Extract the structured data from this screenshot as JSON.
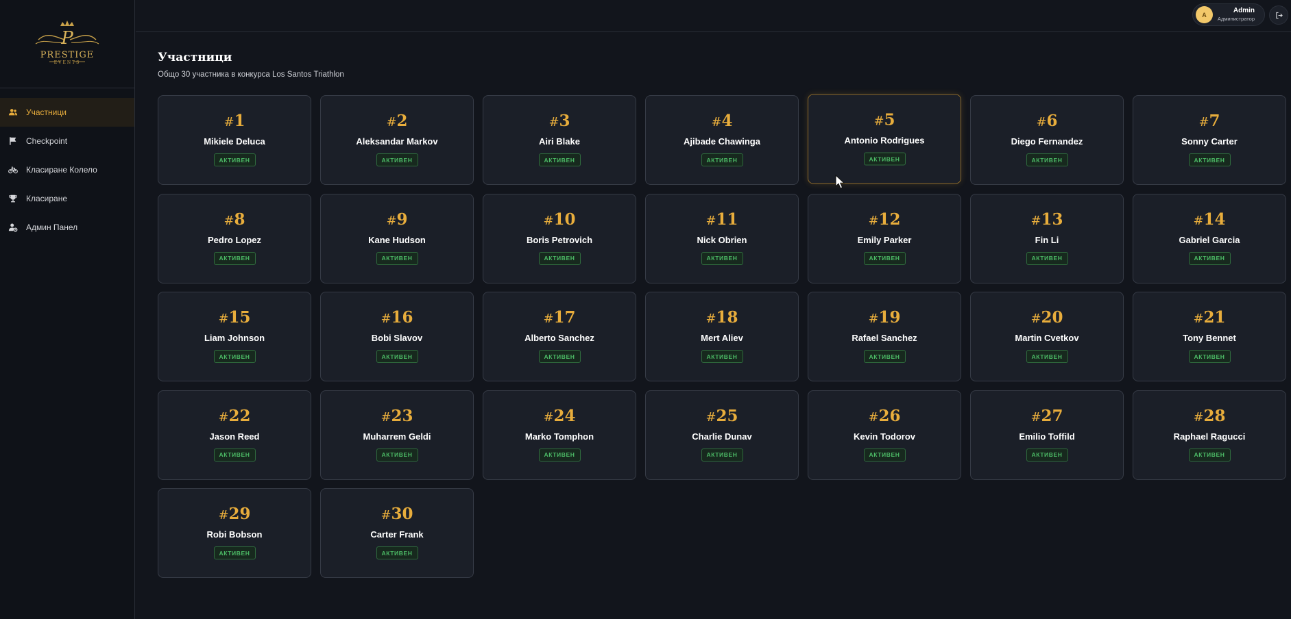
{
  "brand": {
    "logo_text": "PRESTIGE",
    "logo_subtext": "EVENTS",
    "logo_initial": "P"
  },
  "sidebar": {
    "items": [
      {
        "label": "Участници",
        "icon": "users-icon",
        "active": true
      },
      {
        "label": "Checkpoint",
        "icon": "flag-icon",
        "active": false
      },
      {
        "label": "Класиране Колело",
        "icon": "bicycle-icon",
        "active": false
      },
      {
        "label": "Класиране",
        "icon": "trophy-icon",
        "active": false
      },
      {
        "label": "Админ Панел",
        "icon": "admin-cog-icon",
        "active": false
      }
    ]
  },
  "header": {
    "user": {
      "initial": "A",
      "name": "Admin",
      "role": "Администратор"
    },
    "logout_icon": "logout-icon"
  },
  "page": {
    "title": "Участници",
    "subtitle": "Общо 30 участника в конкурса Los Santos Triathlon"
  },
  "participants": [
    {
      "number": "1",
      "name": "Mikiele Deluca",
      "status": "АКТИВЕН"
    },
    {
      "number": "2",
      "name": "Aleksandar Markov",
      "status": "АКТИВЕН"
    },
    {
      "number": "3",
      "name": "Airi Blake",
      "status": "АКТИВЕН"
    },
    {
      "number": "4",
      "name": "Ajibade Chawinga",
      "status": "АКТИВЕН"
    },
    {
      "number": "5",
      "name": "Antonio Rodrigues",
      "status": "АКТИВЕН"
    },
    {
      "number": "6",
      "name": "Diego Fernandez",
      "status": "АКТИВЕН"
    },
    {
      "number": "7",
      "name": "Sonny Carter",
      "status": "АКТИВЕН"
    },
    {
      "number": "8",
      "name": "Pedro Lopez",
      "status": "АКТИВЕН"
    },
    {
      "number": "9",
      "name": "Kane Hudson",
      "status": "АКТИВЕН"
    },
    {
      "number": "10",
      "name": "Boris Petrovich",
      "status": "АКТИВЕН"
    },
    {
      "number": "11",
      "name": "Nick Obrien",
      "status": "АКТИВЕН"
    },
    {
      "number": "12",
      "name": "Emily Parker",
      "status": "АКТИВЕН"
    },
    {
      "number": "13",
      "name": "Fin Li",
      "status": "АКТИВЕН"
    },
    {
      "number": "14",
      "name": "Gabriel Garcia",
      "status": "АКТИВЕН"
    },
    {
      "number": "15",
      "name": "Liam Johnson",
      "status": "АКТИВЕН"
    },
    {
      "number": "16",
      "name": "Bobi Slavov",
      "status": "АКТИВЕН"
    },
    {
      "number": "17",
      "name": "Alberto Sanchez",
      "status": "АКТИВЕН"
    },
    {
      "number": "18",
      "name": "Mert Aliev",
      "status": "АКТИВЕН"
    },
    {
      "number": "19",
      "name": "Rafael Sanchez",
      "status": "АКТИВЕН"
    },
    {
      "number": "20",
      "name": "Martin Cvetkov",
      "status": "АКТИВЕН"
    },
    {
      "number": "21",
      "name": "Tony Bennet",
      "status": "АКТИВЕН"
    },
    {
      "number": "22",
      "name": "Jason Reed",
      "status": "АКТИВЕН"
    },
    {
      "number": "23",
      "name": "Muharrem Geldi",
      "status": "АКТИВЕН"
    },
    {
      "number": "24",
      "name": "Marko Tomphon",
      "status": "АКТИВЕН"
    },
    {
      "number": "25",
      "name": "Charlie Dunav",
      "status": "АКТИВЕН"
    },
    {
      "number": "26",
      "name": "Kevin Todorov",
      "status": "АКТИВЕН"
    },
    {
      "number": "27",
      "name": "Emilio Toffild",
      "status": "АКТИВЕН"
    },
    {
      "number": "28",
      "name": "Raphael Ragucci",
      "status": "АКТИВЕН"
    },
    {
      "number": "29",
      "name": "Robi Bobson",
      "status": "АКТИВЕН"
    },
    {
      "number": "30",
      "name": "Carter Frank",
      "status": "АКТИВЕН"
    }
  ],
  "hovered_participant": "5",
  "colors": {
    "accent_gold": "#e8ad3c",
    "status_green": "#4cbb66",
    "background": "#12151c",
    "card": "#1b1f28"
  }
}
